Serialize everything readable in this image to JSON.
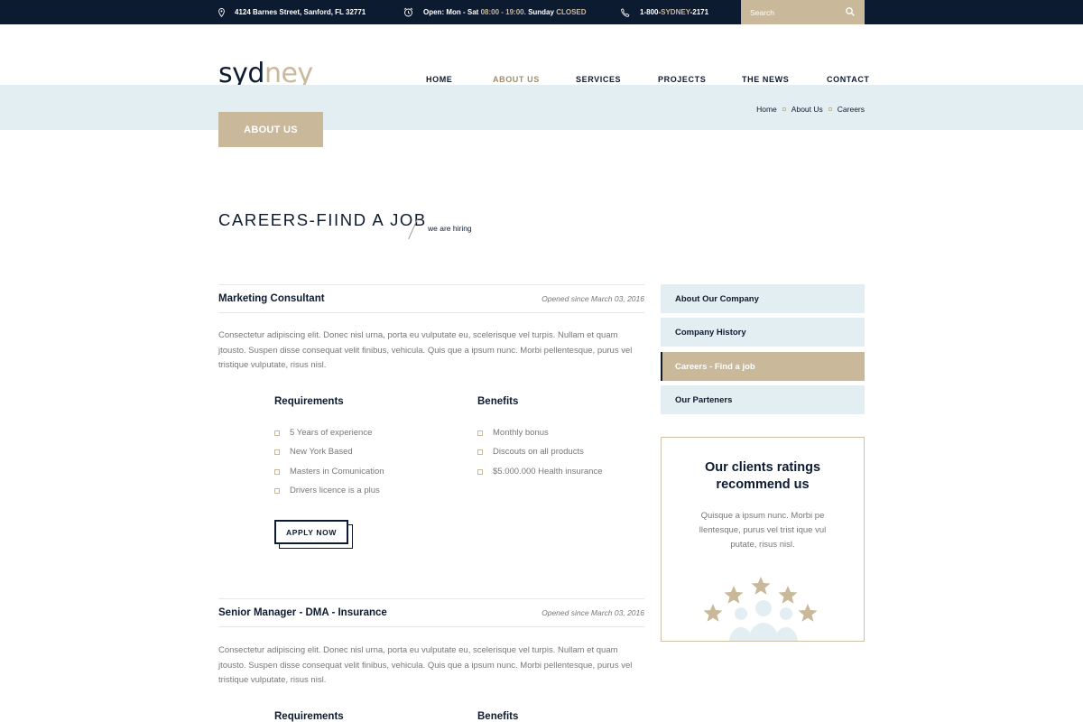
{
  "topbar": {
    "address": "4124 Barnes Street, Sanford, FL 32771",
    "hours_prefix": "Open:  Mon - Sat",
    "hours_time": "08:00 - 19:00.",
    "hours_sunday": "Sunday",
    "hours_closed": "CLOSED",
    "phone_a": "1-800-",
    "phone_b": "SYDNEY",
    "phone_c": "-2171",
    "search_placeholder": "Search",
    "icons": {
      "address": "map-pin-icon",
      "hours": "clock-icon",
      "phone": "phone-icon",
      "search": "search-icon"
    }
  },
  "logo": {
    "part1": "syd",
    "part2": "ney"
  },
  "nav": [
    {
      "label": "HOME"
    },
    {
      "label": "ABOUT US",
      "active": true
    },
    {
      "label": "SERVICES"
    },
    {
      "label": "PROJECTS"
    },
    {
      "label": "THE NEWS"
    },
    {
      "label": "CONTACT"
    }
  ],
  "breadcrumb": [
    "Home",
    "About Us",
    "Careers"
  ],
  "page_badge": "ABOUT US",
  "page_title": "CAREERS-FIIND A JOB",
  "page_subtitle": "we are hiring",
  "jobs": [
    {
      "title": "Marketing Consultant",
      "date": "Opened since March 03, 2016",
      "description": "Consectetur adipiscing elit. Donec nisl urna, porta eu vulputate eu, scelerisque vel turpis. Nullam et quam jtousto. Suspen disse consequat velit finibus, vehicula. Quis que a ipsum nunc. Morbi pellentesque, purus vel tristique vulputate, risus nisl.",
      "requirements_label": "Requirements",
      "requirements": [
        "5 Years of experience",
        "New York Based",
        "Masters in Comunication",
        "Drivers licence is a plus"
      ],
      "benefits_label": "Benefits",
      "benefits": [
        "Monthly bonus",
        "Discouts on all products",
        "$5.000.000 Health insurance"
      ],
      "apply_label": "APPLY NOW"
    },
    {
      "title": "Senior Manager - DMA - Insurance",
      "date": "Opened since March 03, 2016",
      "description": "Consectetur adipiscing elit. Donec nisl urna, porta eu vulputate eu, scelerisque vel turpis. Nullam et quam jtousto. Suspen disse consequat velit finibus, vehicula. Quis que a ipsum nunc. Morbi pellentesque, purus vel tristique vulputate, risus nisl.",
      "requirements_label": "Requirements",
      "benefits_label": "Benefits"
    }
  ],
  "sidebar": [
    {
      "label": "About Our Company"
    },
    {
      "label": "Company History"
    },
    {
      "label": "Careers - Find a job",
      "active": true
    },
    {
      "label": "Our Parteners"
    }
  ],
  "rating_box": {
    "title": "Our clients ratings recommend us",
    "text": "Quisque a ipsum nunc. Morbi pe llentesque, purus vel trist ique vul putate, risus nisl.",
    "icon": "stars-people-icon"
  },
  "colors": {
    "navy": "#0d1b31",
    "gold": "#c9b99a",
    "light_blue": "#e3eef3"
  }
}
